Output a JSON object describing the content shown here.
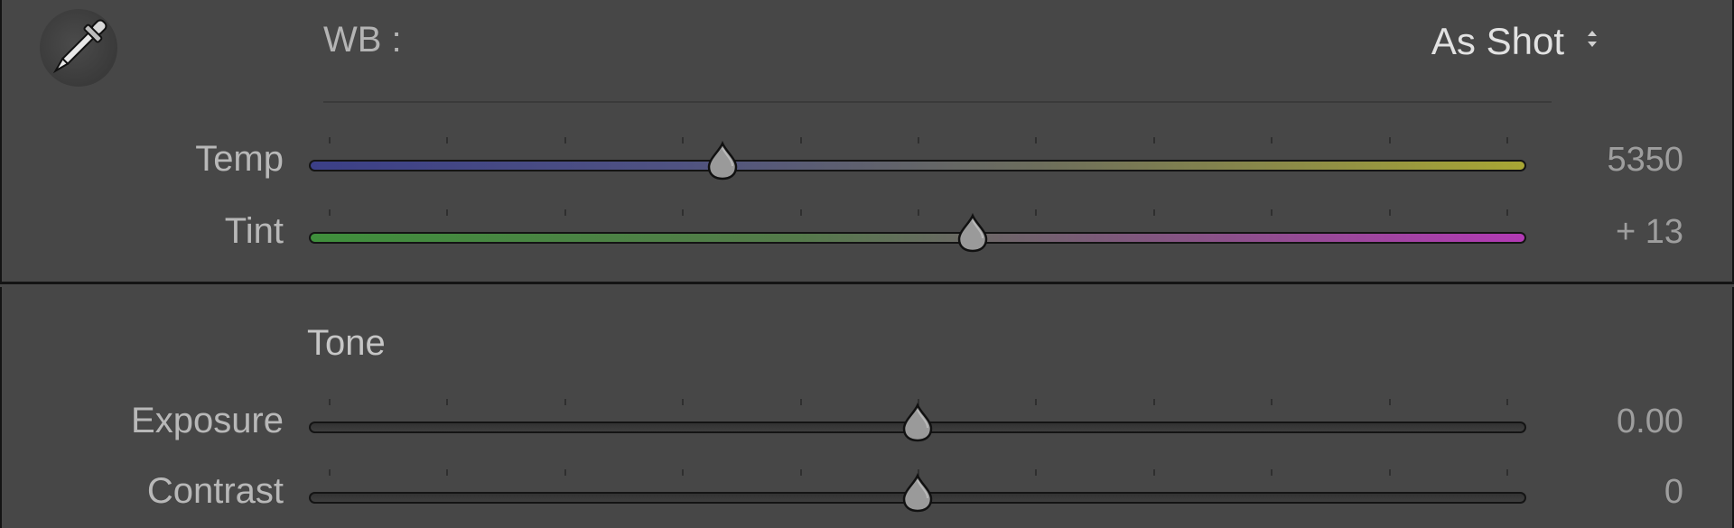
{
  "white_balance": {
    "label": "WB :",
    "preset_value": "As Shot",
    "eyedropper_icon": "eyedropper-icon",
    "sliders": [
      {
        "id": "temp",
        "label": "Temp",
        "value": "5350",
        "position": 0.34,
        "track": "temp"
      },
      {
        "id": "tint",
        "label": "Tint",
        "value": "+ 13",
        "position": 0.545,
        "track": "tint"
      }
    ]
  },
  "tone": {
    "title": "Tone",
    "sliders": [
      {
        "id": "exposure",
        "label": "Exposure",
        "value": "0.00",
        "position": 0.5,
        "track": "gray"
      },
      {
        "id": "contrast",
        "label": "Contrast",
        "value": "0",
        "position": 0.5,
        "track": "gray"
      }
    ]
  },
  "colors": {
    "panel_background": "#474747",
    "panel_border": "#141414",
    "label_text": "#b8b8b8",
    "value_text": "#9e9e9e",
    "selected_text": "#e2e2e2"
  }
}
